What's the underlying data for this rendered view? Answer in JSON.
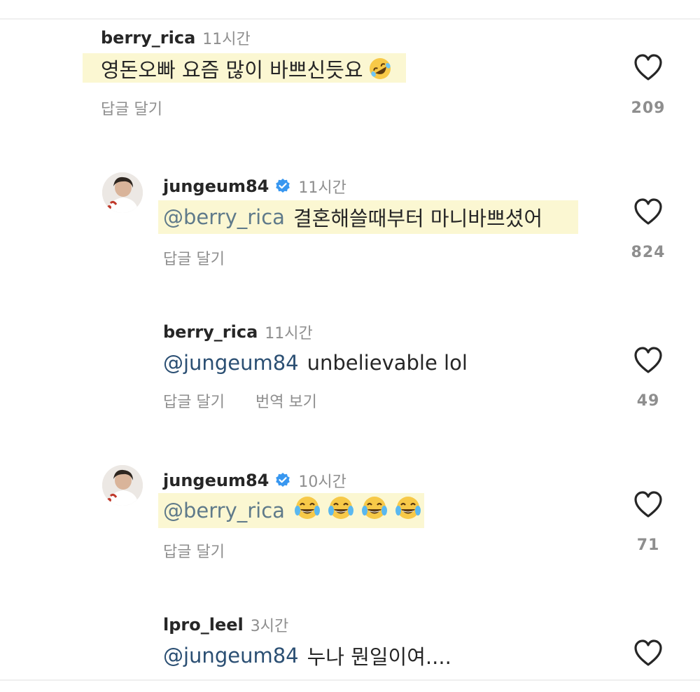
{
  "comments": [
    {
      "username": "berry_rica",
      "time": "11시간",
      "text": "영돈오빠 요즘 많이 바쁘신듯요",
      "reply_label": "답글 달기",
      "likes": "209"
    },
    {
      "username": "jungeum84",
      "time": "11시간",
      "mention": "@berry_rica",
      "text": "결혼해쓸때부터 마니바쁘셨어",
      "reply_label": "답글 달기",
      "likes": "824"
    },
    {
      "username": "berry_rica",
      "time": "11시간",
      "mention": "@jungeum84",
      "text": "unbelievable lol",
      "reply_label": "답글 달기",
      "translate_label": "번역 보기",
      "likes": "49"
    },
    {
      "username": "jungeum84",
      "time": "10시간",
      "mention": "@berry_rica",
      "reply_label": "답글 달기",
      "likes": "71"
    },
    {
      "username": "lpro_leel",
      "time": "3시간",
      "mention": "@jungeum84",
      "text": "누나 뭔일이여...."
    }
  ],
  "icons": {
    "like": "heart-outline-icon",
    "verified": "verified-badge-icon",
    "emoji_rofl": "rolling-on-floor-laughing-emoji",
    "emoji_joy": "face-with-tears-of-joy-emoji"
  },
  "colors": {
    "highlight": "#fbf7d2",
    "mention": "#2b4f73",
    "verified": "#3897f0",
    "secondary_text": "#8e8e8e"
  }
}
